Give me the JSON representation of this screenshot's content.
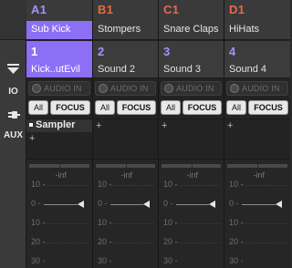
{
  "rail": {
    "io_label": "IO",
    "aux_label": "AUX"
  },
  "columns": [
    {
      "group_code": "A1",
      "group_name": "Sub Kick",
      "sound_number": "1",
      "sound_name": "Kick..utEvil",
      "audio_in_label": "AUDIO IN",
      "all_label": "All",
      "focus_label": "FOCUS",
      "plugin_name": "Sampler",
      "add_label": "+",
      "meter_readout": "-inf",
      "ticks": [
        "10 -",
        "0 -",
        "10 -",
        "20 -",
        "30 -"
      ]
    },
    {
      "group_code": "B1",
      "group_name": "Stompers",
      "sound_number": "2",
      "sound_name": "Sound 2",
      "audio_in_label": "AUDIO IN",
      "all_label": "All",
      "focus_label": "FOCUS",
      "add_label": "+",
      "meter_readout": "-inf",
      "ticks": [
        "10 -",
        "0 -",
        "10 -",
        "20 -",
        "30 -"
      ]
    },
    {
      "group_code": "C1",
      "group_name": "Snare Claps",
      "sound_number": "3",
      "sound_name": "Sound 3",
      "audio_in_label": "AUDIO IN",
      "all_label": "All",
      "focus_label": "FOCUS",
      "add_label": "+",
      "meter_readout": "-inf",
      "ticks": [
        "10 -",
        "0 -",
        "10 -",
        "20 -",
        "30 -"
      ]
    },
    {
      "group_code": "D1",
      "group_name": "HiHats",
      "sound_number": "4",
      "sound_name": "Sound 4",
      "audio_in_label": "AUDIO IN",
      "all_label": "All",
      "focus_label": "FOCUS",
      "add_label": "+",
      "meter_readout": "-inf",
      "ticks": [
        "10 -",
        "0 -",
        "10 -",
        "20 -",
        "30 -"
      ]
    }
  ],
  "colors": {
    "selected_accent": "#8c6ff5",
    "group_a_label": "#a98fff",
    "group_label_orange": "#e8694a"
  },
  "icons": {
    "collapse": "collapse-arrow-icon",
    "plug": "plug-icon",
    "audio_in_knob": "knob-icon",
    "fader_handle": "fader-handle-icon"
  }
}
